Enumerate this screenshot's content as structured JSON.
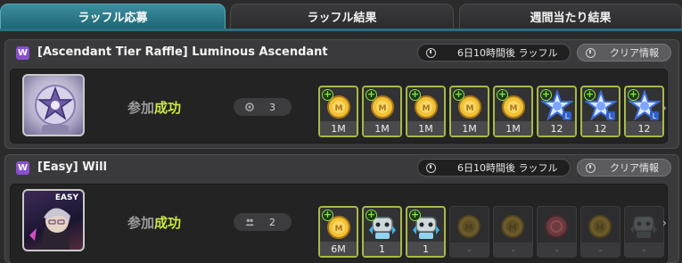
{
  "tabs": [
    {
      "label": "ラッフル応募",
      "active": true
    },
    {
      "label": "ラッフル結果",
      "active": false
    },
    {
      "label": "週間当たり結果",
      "active": false
    }
  ],
  "raffles": [
    {
      "badge": "W",
      "title": "[Ascendant Tier Raffle] Luminous Ascendant",
      "timer": "6日10時間後 ラッフル",
      "clear_info": "クリア情報",
      "status_prefix": "参加",
      "status_result": "成功",
      "entries": "3",
      "entries_icon": "coin-stack-icon",
      "items": [
        {
          "icon": "gold-coin-icon",
          "qty": "1M"
        },
        {
          "icon": "gold-coin-icon",
          "qty": "1M"
        },
        {
          "icon": "gold-coin-icon",
          "qty": "1M"
        },
        {
          "icon": "gold-coin-icon",
          "qty": "1M"
        },
        {
          "icon": "gold-coin-icon",
          "qty": "1M"
        },
        {
          "icon": "star-shard-icon",
          "qty": "12"
        },
        {
          "icon": "star-shard-icon",
          "qty": "12"
        },
        {
          "icon": "star-shard-icon",
          "qty": "12"
        }
      ]
    },
    {
      "badge": "W",
      "title": "[Easy] Will",
      "timer": "6日10時間後 ラッフル",
      "clear_info": "クリア情報",
      "status_prefix": "参加",
      "status_result": "成功",
      "entries": "2",
      "entries_icon": "party-icon",
      "portrait_tag": "EASY",
      "items": [
        {
          "icon": "gold-coin-icon",
          "qty": "6M"
        },
        {
          "icon": "robot-pet-icon",
          "qty": "1"
        },
        {
          "icon": "robot-pet-icon",
          "qty": "1"
        },
        {
          "icon": "gold-coin-icon",
          "qty": "-"
        },
        {
          "icon": "gold-coin-icon",
          "qty": "-"
        },
        {
          "icon": "pink-coin-icon",
          "qty": "-"
        },
        {
          "icon": "gold-coin-icon",
          "qty": "-"
        },
        {
          "icon": "robot-pet-icon",
          "qty": "-"
        }
      ]
    }
  ],
  "colors": {
    "accent": "#2a7081",
    "success": "#c8e840",
    "badge": "#8a4fd0"
  }
}
